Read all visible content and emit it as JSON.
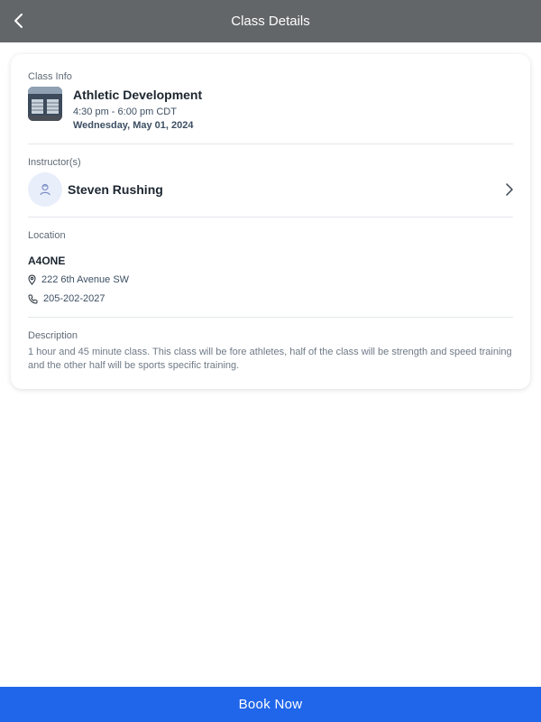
{
  "header": {
    "title": "Class Details",
    "back_icon": "chevron-left-icon"
  },
  "class_info": {
    "section_label": "Class Info",
    "name": "Athletic Development",
    "time": "4:30 pm - 6:00 pm CDT",
    "date": "Wednesday, May 01, 2024"
  },
  "instructors": {
    "section_label": "Instructor(s)",
    "name": "Steven Rushing",
    "avatar_icon": "person-icon",
    "chevron_icon": "chevron-right-icon"
  },
  "location": {
    "section_label": "Location",
    "name": "A4ONE",
    "address": "222 6th Avenue SW",
    "phone": "205-202-2027",
    "address_icon": "map-pin-icon",
    "phone_icon": "phone-icon"
  },
  "description": {
    "section_label": "Description",
    "text": "1 hour and 45 minute class. This class will be fore athletes, half of the class will be strength and speed training and the other half will be sports specific training."
  },
  "footer": {
    "book_label": "Book Now",
    "accent": "#2066ea"
  },
  "colors": {
    "header_bg": "#636669",
    "accent": "#2066ea"
  }
}
